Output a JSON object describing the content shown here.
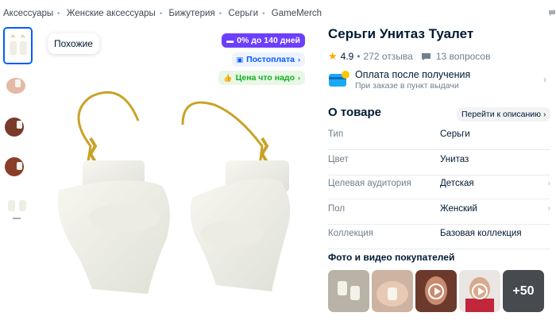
{
  "breadcrumb": [
    "Аксессуары",
    "Женские аксессуары",
    "Бижутерия",
    "Серьги",
    "GameMerch"
  ],
  "gallery": {
    "similar_label": "Похожие",
    "badges": {
      "installment": "0% до 140 дней",
      "postpay": "Постоплата",
      "price": "Цена что надо"
    }
  },
  "product": {
    "title": "Серьги Унитаз Туалет",
    "rating": "4.9",
    "reviews": "272 отзыва",
    "questions": "13 вопросов"
  },
  "payment": {
    "title": "Оплата после получения",
    "subtitle": "При заказе в пункт выдачи"
  },
  "about": {
    "heading": "О товаре",
    "to_description": "Перейти к описанию",
    "specs": [
      {
        "key": "Тип",
        "value": "Серьги"
      },
      {
        "key": "Цвет",
        "value": "Унитаз"
      },
      {
        "key": "Целевая аудитория",
        "value": "Детская"
      },
      {
        "key": "Пол",
        "value": "Женский"
      },
      {
        "key": "Коллекция",
        "value": "Базовая коллекция"
      }
    ]
  },
  "photos": {
    "heading": "Фото и видео покупателей",
    "more_label": "+50"
  },
  "colors": {
    "accent": "#005bff",
    "installment": "#6d3ffc",
    "price_green": "#10b021",
    "star": "#ffa800"
  }
}
